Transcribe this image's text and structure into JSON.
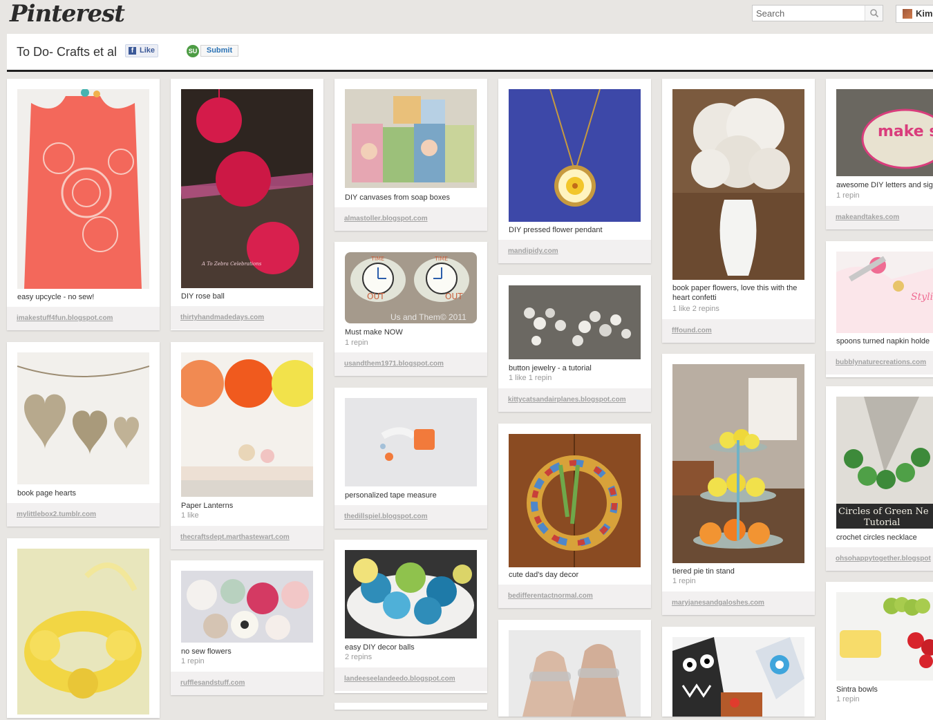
{
  "header": {
    "logo": "Pinterest",
    "search_placeholder": "Search",
    "user_name": "Kim"
  },
  "board": {
    "title": "To Do- Crafts et al",
    "like_label": "Like",
    "submit_label": "Submit",
    "su_badge": "SU"
  },
  "pins": [
    {
      "desc": "easy upcycle - no sew!",
      "stats": "",
      "source": "imakestuff4fun.blogspot.com",
      "colors": [
        "#f46a5e",
        "#e8483c",
        "#f2b8b0"
      ]
    },
    {
      "desc": "book page hearts",
      "stats": "",
      "source": "mylittlebox2.tumblr.com",
      "colors": [
        "#f2f2ef",
        "#b7a98d",
        "#8c7d60"
      ]
    },
    {
      "desc": "",
      "stats": "",
      "source": "",
      "colors": [
        "#e9e6b4",
        "#f2d644",
        "#c9a720"
      ]
    },
    {
      "desc": "DIY rose ball",
      "stats": "",
      "source": "thirtyhandmadedays.com",
      "colors": [
        "#2e2520",
        "#d41b4a",
        "#e55ca8"
      ]
    },
    {
      "desc": "Paper Lanterns",
      "stats": "1 like",
      "source": "thecraftsdept.marthastewart.com",
      "colors": [
        "#f4f1ec",
        "#f18a52",
        "#f2e24b"
      ]
    },
    {
      "desc": "no sew flowers",
      "stats": "1 repin",
      "source": "rufflesandstuff.com",
      "colors": [
        "#dcdce2",
        "#d43a63",
        "#f2c7c7"
      ]
    },
    {
      "desc": "DIY canvases from soap boxes",
      "stats": "",
      "source": "almastoller.blogspot.com",
      "colors": [
        "#d8d3c6",
        "#9cc07a",
        "#5a8fb2"
      ]
    },
    {
      "desc": "Must make NOW",
      "stats": "1 repin",
      "source": "usandthem1971.blogspot.com",
      "colors": [
        "#a59a8c",
        "#e2e4d8",
        "#c95f3c"
      ]
    },
    {
      "desc": "personalized tape measure",
      "stats": "",
      "source": "thedillspiel.blogspot.com",
      "colors": [
        "#e6e6e8",
        "#f27a3b",
        "#a4c0d8"
      ]
    },
    {
      "desc": "easy DIY decor balls",
      "stats": "2 repins",
      "source": "landeeseelandeedo.blogspot.com",
      "colors": [
        "#343434",
        "#2f8db9",
        "#8fc24d"
      ]
    },
    {
      "desc": "DIY pressed flower pendant",
      "stats": "",
      "source": "mandipidy.com",
      "colors": [
        "#3d48a8",
        "#2e3a8f",
        "#f2c62a"
      ]
    },
    {
      "desc": "button jewelry - a tutorial",
      "stats": "1 like  1 repin",
      "source": "kittycatsandairplanes.blogspot.com",
      "colors": [
        "#6b6862",
        "#e4e2dd",
        "#9f9b94"
      ]
    },
    {
      "desc": "cute dad's day decor",
      "stats": "",
      "source": "bedifferentactnormal.com",
      "colors": [
        "#8a4b22",
        "#a95e2a",
        "#4f87c9"
      ]
    },
    {
      "desc": "",
      "stats": "",
      "source": "",
      "colors": [
        "#d9b9a4",
        "#c49a82",
        "#eaeaea"
      ]
    },
    {
      "desc": "book paper flowers, love this with the heart confetti",
      "stats": "1 like  2 repins",
      "source": "fffound.com",
      "colors": [
        "#7b5a3e",
        "#e9e5de",
        "#f4f4f2"
      ]
    },
    {
      "desc": "tiered pie tin stand",
      "stats": "1 repin",
      "source": "maryjanesandgaloshes.com",
      "colors": [
        "#6a4b34",
        "#f1e14b",
        "#f29432"
      ]
    },
    {
      "desc": "",
      "stats": "",
      "source": "",
      "colors": [
        "#2b2b2b",
        "#f2f2f2",
        "#e03c2d"
      ]
    },
    {
      "desc": "awesome DIY letters and sig",
      "stats": "1 repin",
      "source": "makeandtakes.com",
      "colors": [
        "#6a6760",
        "#e8e2d0",
        "#d93d7c"
      ]
    },
    {
      "desc": "spoons turned napkin holde",
      "stats": "",
      "source": "bubblynaturecreations.com",
      "colors": [
        "#f6f0f0",
        "#ef6c93",
        "#e8c46a"
      ]
    },
    {
      "desc": "crochet circles necklace",
      "stats": "",
      "source": "ohsohappytogether.blogspot",
      "colors": [
        "#b9b5ad",
        "#3d8a3a",
        "#e0ddd7"
      ]
    },
    {
      "desc": "Sintra bowls",
      "stats": "1 repin",
      "source": "",
      "colors": [
        "#f3f3f1",
        "#9ac244",
        "#d8242c"
      ]
    }
  ],
  "overlay_texts": {
    "rose_ball_watermark": "A To Zebra Celebrations",
    "clock_watermark": "Us and Them© 2011",
    "clock_label_time": "TIME",
    "clock_label_out": "OUT",
    "make_stuff": "make stuff",
    "circles_caption": "Circles of Green Ne",
    "tutorial_caption": "Tutorial",
    "napkin_text": "Stylish Napki"
  }
}
